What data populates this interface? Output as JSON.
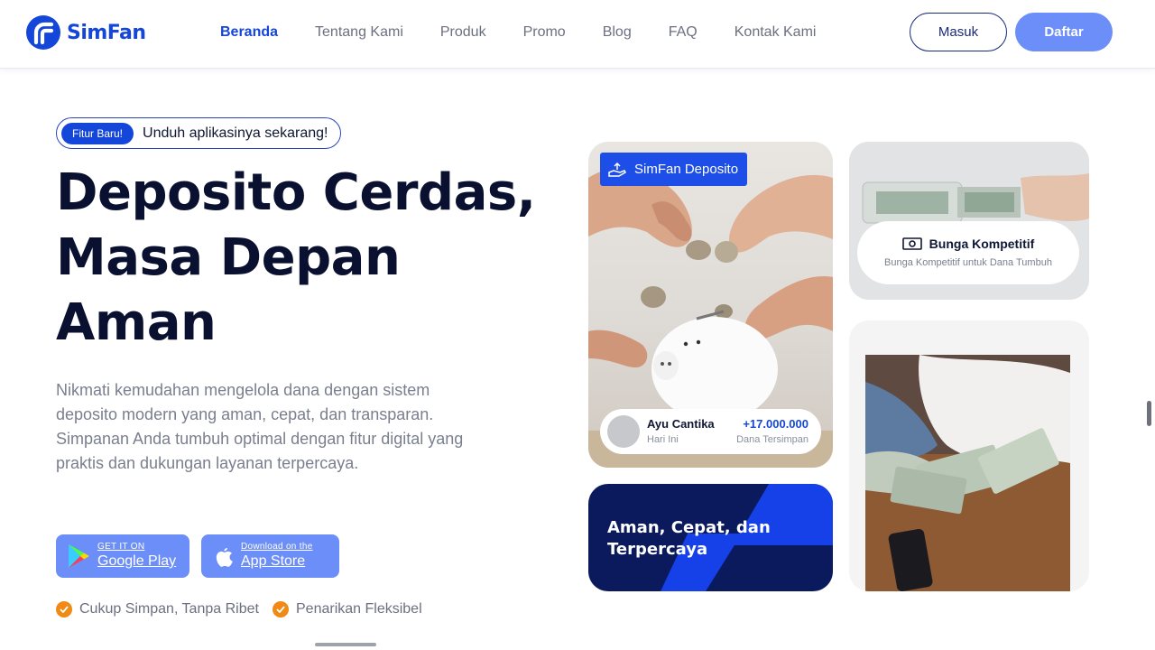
{
  "brand": {
    "name": "SimFan",
    "color": "#1446d9"
  },
  "nav": {
    "items": [
      {
        "label": "Beranda",
        "active": true
      },
      {
        "label": "Tentang Kami"
      },
      {
        "label": "Produk"
      },
      {
        "label": "Promo"
      },
      {
        "label": "Blog"
      },
      {
        "label": "FAQ"
      },
      {
        "label": "Kontak Kami"
      }
    ],
    "login_label": "Masuk",
    "register_label": "Daftar"
  },
  "hero": {
    "badge": "Fitur Baru!",
    "badge_text": "Unduh aplikasinya sekarang!",
    "title_lines": [
      "Deposito Cerdas,",
      "Masa Depan",
      "Aman"
    ],
    "description": "Nikmati kemudahan mengelola dana dengan sistem deposito modern yang aman, cepat, dan transparan. Simpanan Anda tumbuh optimal dengan fitur digital yang praktis dan dukungan layanan terpercaya.",
    "stores": {
      "google": {
        "small": "GET IT ON",
        "big": "Google Play"
      },
      "apple": {
        "small": "Download on the",
        "big": "App Store"
      }
    },
    "checks": [
      "Cukup Simpan, Tanpa Ribet",
      "Penarikan Fleksibel"
    ]
  },
  "cards": {
    "deposito_badge": "SimFan Deposito",
    "saver": {
      "name": "Ayu Cantika",
      "time": "Hari Ini",
      "amount": "+17.000.000",
      "amount_label": "Dana Tersimpan"
    },
    "bunga": {
      "title": "Bunga Kompetitif",
      "subtitle": "Bunga Kompetitif untuk Dana Tumbuh"
    },
    "tagline": "Aman, Cepat, dan Terpercaya"
  },
  "colors": {
    "accent": "#6c8ef8",
    "primary": "#1446d9",
    "dark_navy": "#0a1a5c",
    "check_orange": "#f08a15"
  }
}
